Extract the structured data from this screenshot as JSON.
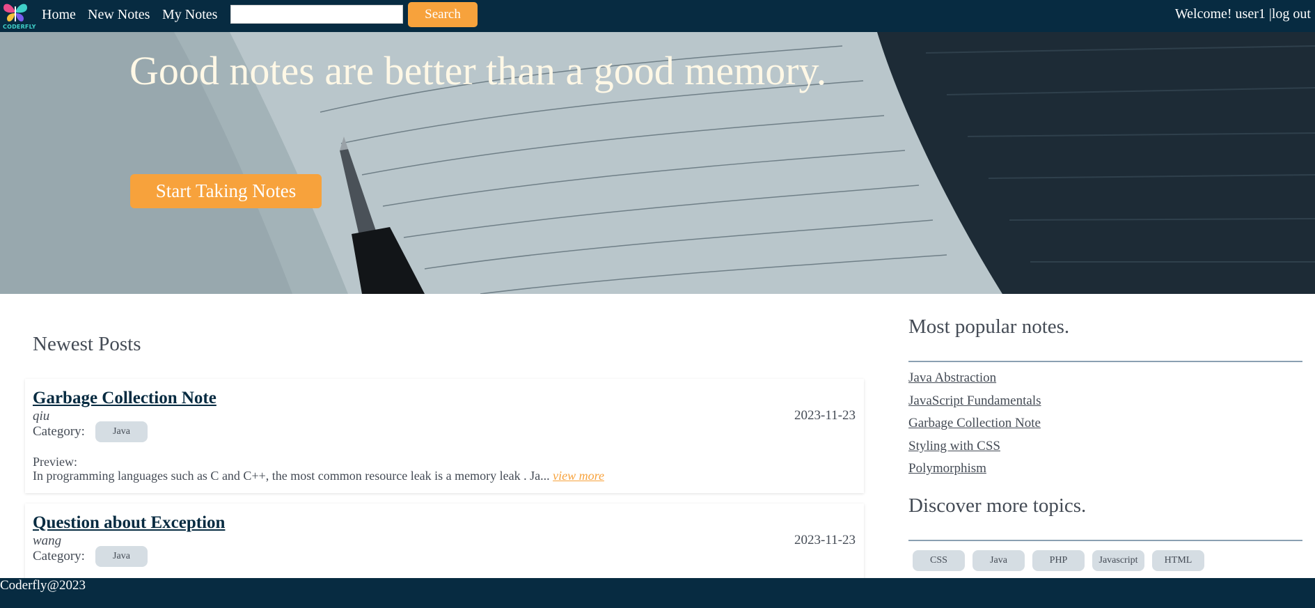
{
  "nav": {
    "logo_text": "CODERFLY",
    "home": "Home",
    "new_notes": "New Notes",
    "my_notes": "My Notes",
    "search_value": "",
    "search_button": "Search",
    "welcome": "Welcome! user1 |log out"
  },
  "hero": {
    "title": "Good notes are better than a good memory.",
    "button": "Start Taking Notes"
  },
  "newest": {
    "heading": "Newest Posts",
    "category_label": "Category:",
    "preview_label": "Preview:",
    "view_more": "view more",
    "posts": [
      {
        "title": "Garbage Collection Note",
        "author": "qiu",
        "date": "2023-11-23",
        "category": "Java",
        "preview": "In programming languages such as C and C++, the most common resource leak is a memory leak . Ja..."
      },
      {
        "title": "Question about Exception",
        "author": "wang",
        "date": "2023-11-23",
        "category": "Java"
      }
    ]
  },
  "sidebar": {
    "popular_heading": "Most popular notes.",
    "popular": [
      "Java Abstraction",
      "JavaScript Fundamentals",
      "Garbage Collection Note",
      "Styling with CSS",
      "Polymorphism"
    ],
    "topics_heading": "Discover more topics.",
    "topics": [
      "CSS",
      "Java",
      "PHP",
      "Javascript",
      "HTML"
    ]
  },
  "footer": {
    "text": "Coderfly@2023"
  },
  "colors": {
    "nav_bg": "#072b41",
    "accent": "#f7a23c",
    "tag_bg": "#d5dde3"
  }
}
